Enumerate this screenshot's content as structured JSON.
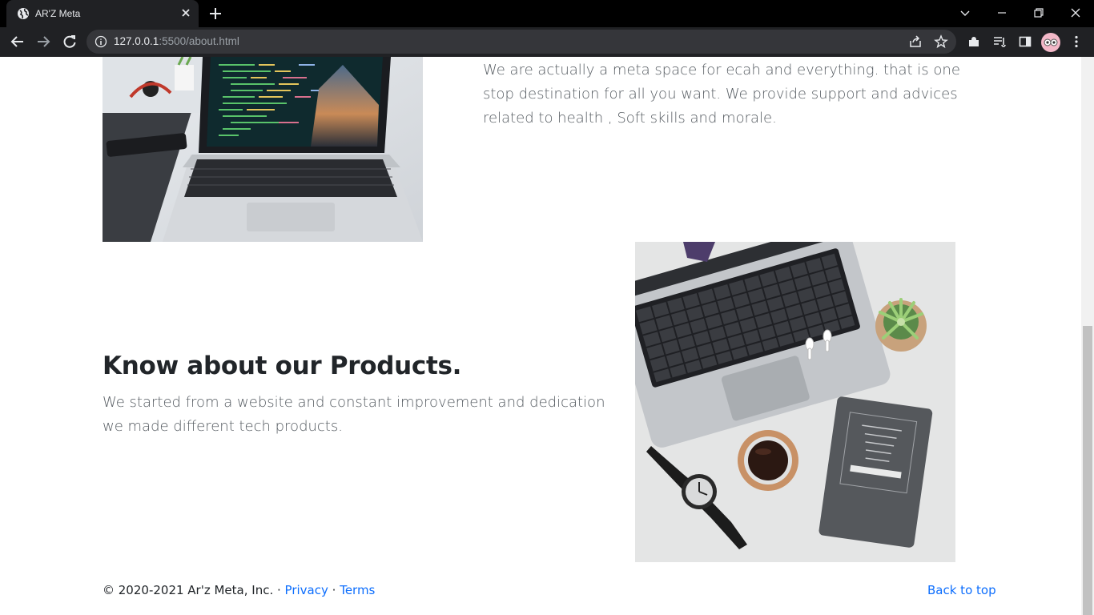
{
  "browser": {
    "tab_title": "AR'Z Meta",
    "url_host": "127.0.0.1",
    "url_rest": ":5500/about.html"
  },
  "section_meta": {
    "text": "We are actually a meta space for ecah and everything. that is one stop destination for all you want. We provide support and advices related to health , Soft skills and morale."
  },
  "section_products": {
    "heading": "Know about our Products.",
    "text": "We started from a website and constant improvement and dedication we made different tech products."
  },
  "footer": {
    "copyright": "© 2020-2021 Ar'z Meta, Inc. ·",
    "privacy": "Privacy",
    "separator": "·",
    "terms": "Terms",
    "back_to_top": "Back to top"
  },
  "colors": {
    "link": "#0d6efd",
    "text": "#212529",
    "chrome": "#202124"
  }
}
